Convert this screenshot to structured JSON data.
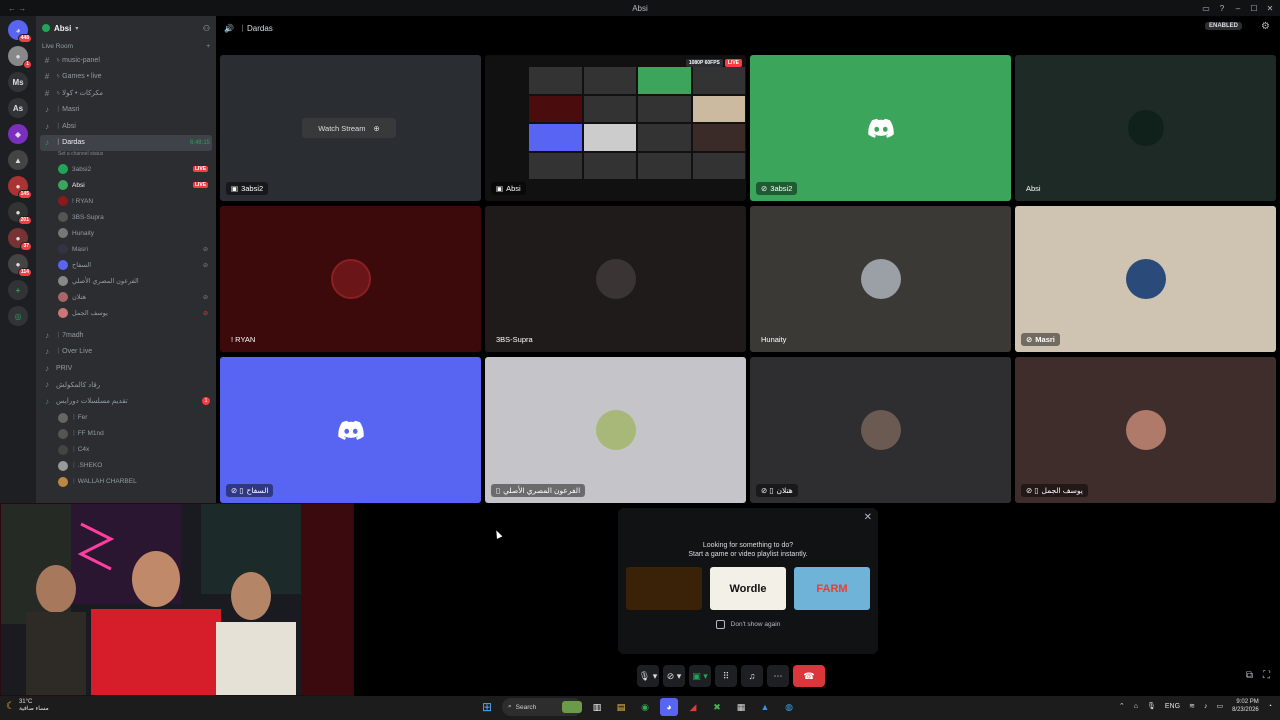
{
  "window": {
    "title": "Absi"
  },
  "guild_badges": [
    "448",
    "1",
    "145",
    "201",
    "37",
    "114"
  ],
  "guild_labels": [
    "Ms",
    "As"
  ],
  "server": {
    "name": "Absi",
    "category": "Live Room"
  },
  "channels_top": [
    {
      "icon": "#",
      "label": "ᛃ music-panel"
    },
    {
      "icon": "#",
      "label": "ᛃ Games • live"
    },
    {
      "icon": "#",
      "label": "ᛃ مكركات • كولا"
    },
    {
      "icon": "♪",
      "label": "ᛁ Masri"
    },
    {
      "icon": "♪",
      "label": "ᛁ Absi"
    }
  ],
  "active_channel": {
    "label": "ᛁ Dardas",
    "time": "6:48:15",
    "status": "Set a channel status"
  },
  "voice_users": [
    {
      "name": "3absi2",
      "live": "LIVE",
      "icons": "",
      "color": "#23a559"
    },
    {
      "name": "Absi",
      "live": "LIVE",
      "icons": "",
      "color": "#3ba55d"
    },
    {
      "name": "! RYAN",
      "live": "",
      "icons": "",
      "color": "#8b1a1a"
    },
    {
      "name": "3BS-Supra",
      "live": "",
      "icons": "",
      "color": "#555"
    },
    {
      "name": "Hunaity",
      "live": "",
      "icons": "",
      "color": "#777"
    },
    {
      "name": "Masri",
      "live": "",
      "icons": "",
      "color": "#334"
    },
    {
      "name": "السفاح",
      "live": "",
      "icons": "",
      "color": "#5865f2"
    },
    {
      "name": "الفرعون المصري الأصلي",
      "live": "",
      "icons": "",
      "color": "#888"
    },
    {
      "name": "هتلان",
      "live": "",
      "icons": "",
      "color": "#a66"
    },
    {
      "name": "يوسف الجمل",
      "live": "",
      "icons": "",
      "color": "#c77"
    }
  ],
  "channels_bottom": [
    {
      "icon": "♪",
      "label": "ᛁ 7madh"
    },
    {
      "icon": "♪",
      "label": "ᛁ Over Live"
    },
    {
      "icon": "♪",
      "label": "PRIV"
    },
    {
      "icon": "♪",
      "label": "رقاد كالمكولش"
    },
    {
      "icon": "♪",
      "label": "تقديم مسلسلات دورايس",
      "badge": "1"
    }
  ],
  "bottom_users": [
    {
      "name": "ᛁ Fer"
    },
    {
      "name": "ᛁ FF M1nd"
    },
    {
      "name": "ᛁ C4x"
    },
    {
      "name": "ᛁ .SHEKO"
    },
    {
      "name": "ᛁ WALLAH CHARBEL"
    }
  ],
  "topbar": {
    "channel": "ᛁ Dardas",
    "enabled": "ENABLED"
  },
  "tiles": [
    {
      "name": "3absi2",
      "overlay": "Watch Stream",
      "bg": "#2a2d32"
    },
    {
      "name": "Absi",
      "badge1": "1080P 60FPS",
      "badge2": "LIVE",
      "bg": "#111"
    },
    {
      "name": "3absi2",
      "bg": "#3ba55c"
    },
    {
      "name": "Absi",
      "bg": "#1d2a26"
    },
    {
      "name": "! RYAN",
      "bg": "#3d0a0c"
    },
    {
      "name": "3BS-Supra",
      "bg": "#1f1b1a"
    },
    {
      "name": "Hunaity",
      "bg": "#3a3936"
    },
    {
      "name": "Masri",
      "bg": "#cfc4b1"
    },
    {
      "name": "السفاح",
      "bg": "#5865f2"
    },
    {
      "name": "الفرعون المصري الأصلي",
      "bg": "#c4c4c9"
    },
    {
      "name": "هتلان",
      "bg": "#2e2d30"
    },
    {
      "name": "يوسف الجمل",
      "bg": "#3e2d2a"
    }
  ],
  "activity": {
    "line1": "Looking for something to do?",
    "line2": "Start a game or video playlist instantly.",
    "games": [
      "",
      "Wordle",
      "FARM"
    ],
    "dont_show": "Don't show again"
  },
  "taskbar": {
    "search": "Search",
    "lang": "ENG",
    "time": "9:02 PM",
    "date": "8/23/2026",
    "weather": [
      "31°C",
      "مساء صافية"
    ]
  }
}
